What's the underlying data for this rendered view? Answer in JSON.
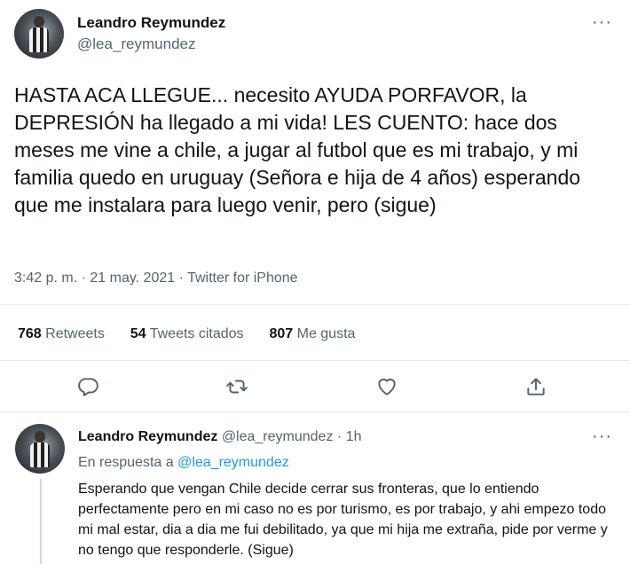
{
  "main_tweet": {
    "author_name": "Leandro Reymundez",
    "author_handle": "@lea_reymundez",
    "text": "HASTA ACA LLEGUE... necesito AYUDA PORFAVOR, la DEPRESIÓN ha llegado a mi vida! LES CUENTO: hace dos meses me vine a chile, a jugar al futbol que es mi trabajo, y mi familia quedo en uruguay (Señora e hija de 4 años) esperando que me instalara para luego venir, pero (sigue)",
    "timestamp": "3:42 p. m. · 21 may. 2021 · Twitter for iPhone",
    "stats": {
      "retweets_count": "768",
      "retweets_label": "Retweets",
      "quotes_count": "54",
      "quotes_label": "Tweets citados",
      "likes_count": "807",
      "likes_label": "Me gusta"
    },
    "actions": [
      "reply-icon",
      "retweet-icon",
      "like-icon",
      "share-icon"
    ]
  },
  "reply_tweet": {
    "author_name": "Leandro Reymundez",
    "author_handle": "@lea_reymundez",
    "separator": "·",
    "time": "1h",
    "reply_prefix": "En respuesta a",
    "reply_to": "@lea_reymundez",
    "text": "Esperando que vengan Chile decide cerrar sus fronteras, que lo entiendo perfectamente pero en mi caso no es por turismo, es por trabajo, y ahi empezo todo mi mal estar, dia a dia me fui debilitado, ya que mi hija me extraña, pide por verme y no tengo que responderle. (Sigue)"
  },
  "colors": {
    "text": "#0f1419",
    "secondary": "#536471",
    "link": "#1d9bf0",
    "divider": "#e6ecf0"
  }
}
